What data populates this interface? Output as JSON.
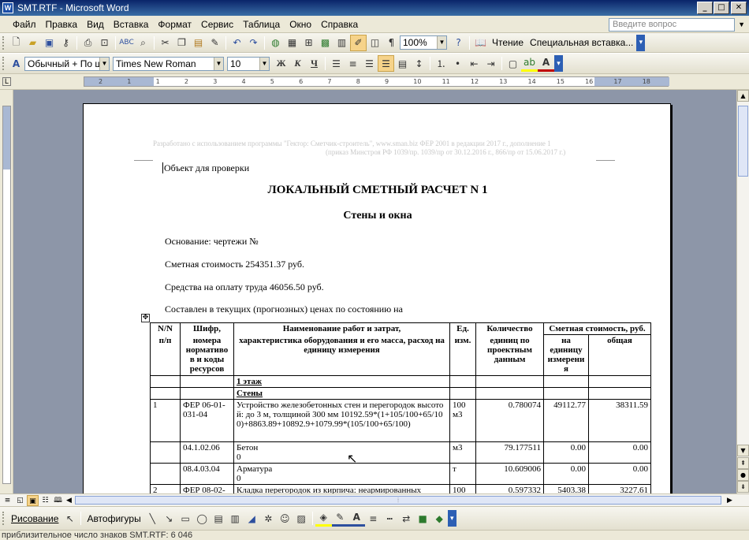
{
  "window": {
    "title": "SMT.RTF - Microsoft Word",
    "min": "_",
    "max": "□",
    "close": "✕"
  },
  "menu": {
    "items": [
      "Файл",
      "Правка",
      "Вид",
      "Вставка",
      "Формат",
      "Сервис",
      "Таблица",
      "Окно",
      "Справка"
    ],
    "ask_placeholder": "Введите вопрос"
  },
  "toolbar_standard": {
    "zoom": "100%",
    "reading_label": "Чтение",
    "paste_special_label": "Специальная вставка..."
  },
  "toolbar_format": {
    "style": "Обычный + По ш",
    "font": "Times New Roman",
    "size": "10",
    "bold": "Ж",
    "italic": "К",
    "underline": "Ч"
  },
  "ruler": {
    "ticks": [
      "2",
      "1",
      "1",
      "2",
      "3",
      "4",
      "5",
      "6",
      "7",
      "8",
      "9",
      "10",
      "11",
      "12",
      "13",
      "14",
      "15",
      "16",
      "17",
      "18"
    ]
  },
  "document": {
    "header_line1": "Разработано с использованием программы \"Гектор: Сметчик-строитель\", www.sman.biz ФЕР 2001 в редакции 2017 г., дополнение 1",
    "header_line2": "(приказ Минстроя РФ 1039/пр. 1039/пр от 30.12.2016 г., 866/пр от 15.06.2017 г.)",
    "object_line": "Объект для проверки",
    "title": "ЛОКАЛЬНЫЙ СМЕТНЫЙ РАСЧЕТ N 1",
    "subtitle": "Стены и окна",
    "basis": "Основание: чертежи №",
    "cost": "Сметная стоимость 254351.37 руб.",
    "wages": "Средства на оплату труда 46056.50 руб.",
    "prices": "Составлен в текущих (прогнозных) ценах по состоянию на"
  },
  "table": {
    "headers": {
      "num_top": "N/N",
      "num_bottom": "п/п",
      "code_top": "Шифр,",
      "code_bottom": "номера нормативо в и коды ресурсов",
      "name_top": "Наименование работ и затрат,",
      "name_bottom": "характеристика оборудования и его масса, расход на единицу измерения",
      "unit_top": "Ед.",
      "unit_bottom": "изм.",
      "qty_top": "Количество",
      "qty_bottom": "единиц по проектным данным",
      "cost_top": "Сметная стоимость, руб.",
      "cost_unit": "на единицу измерени я",
      "cost_total": "общая"
    },
    "sections": [
      "1 этаж",
      "Стены"
    ],
    "rows": [
      {
        "n": "1",
        "code": "ФЕР 06-01-031-04",
        "name": "Устройство железобетонных стен и перегородок высотой: до 3 м, толщиной 300 мм 10192.59*(1+105/100+65/100)+8863.89+10892.9+1079.99*(105/100+65/100)",
        "unit": "100 м3",
        "qty": "0.780074",
        "per_unit": "49112.77",
        "total": "38311.59"
      },
      {
        "n": "",
        "code": "04.1.02.06",
        "name": "Бетон\n0",
        "unit": "м3",
        "qty": "79.177511",
        "per_unit": "0.00",
        "total": "0.00"
      },
      {
        "n": "",
        "code": "08.4.03.04",
        "name": "Арматура\n0",
        "unit": "т",
        "qty": "10.609006",
        "per_unit": "0.00",
        "total": "0.00"
      },
      {
        "n": "2",
        "code": "ФЕР 08-02-",
        "name": "Кладка перегородок из кирпича: неармированных",
        "unit": "100",
        "qty": "0.597332",
        "per_unit": "5403.38",
        "total": "3227.61"
      }
    ]
  },
  "drawing_toolbar": {
    "draw_label": "Рисование",
    "autoshapes_label": "Автофигуры"
  },
  "status": {
    "text": "приблизительное число знаков SMT.RTF: 6 046"
  },
  "colors": {
    "titlebar": "#0a246a",
    "workspace": "#8d96a8",
    "toolbar": "#ece9d8",
    "highlight": "#f6d38a"
  }
}
